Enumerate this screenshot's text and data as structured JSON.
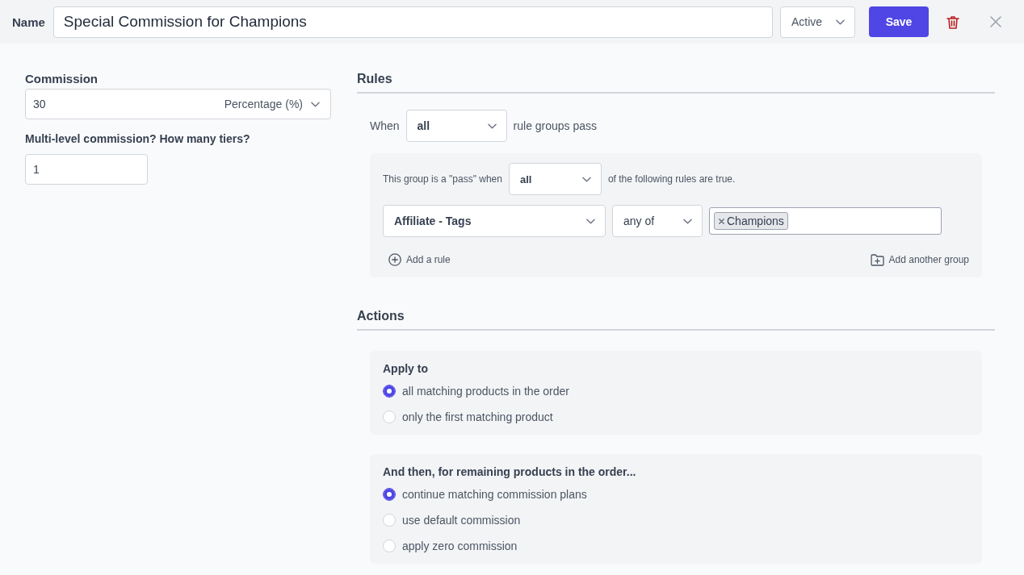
{
  "header": {
    "label": "Name",
    "name_value": "Special Commission for Champions",
    "status": "Active",
    "save": "Save"
  },
  "commission": {
    "label": "Commission",
    "value": "30",
    "type": "Percentage (%)"
  },
  "tiers": {
    "label": "Multi-level commission? How many tiers?",
    "value": "1"
  },
  "rules": {
    "title": "Rules",
    "prefix": "When",
    "match": "all",
    "suffix": "rule groups pass",
    "groups": [
      {
        "prefix": "This group is a \"pass\" when",
        "match": "all",
        "suffix": "of the following rules are true.",
        "rules": [
          {
            "field": "Affiliate - Tags",
            "operator": "any of",
            "tags": [
              "Champions"
            ]
          }
        ],
        "add_rule": "Add a rule",
        "add_group": "Add another group"
      }
    ]
  },
  "actions": {
    "title": "Actions",
    "sections": [
      {
        "title": "Apply to",
        "options": [
          {
            "label": "all matching products in the order",
            "selected": true
          },
          {
            "label": "only the first matching product",
            "selected": false
          }
        ]
      },
      {
        "title": "And then, for remaining products in the order...",
        "options": [
          {
            "label": "continue matching commission plans",
            "selected": true
          },
          {
            "label": "use default commission",
            "selected": false
          },
          {
            "label": "apply zero commission",
            "selected": false
          }
        ]
      }
    ]
  }
}
